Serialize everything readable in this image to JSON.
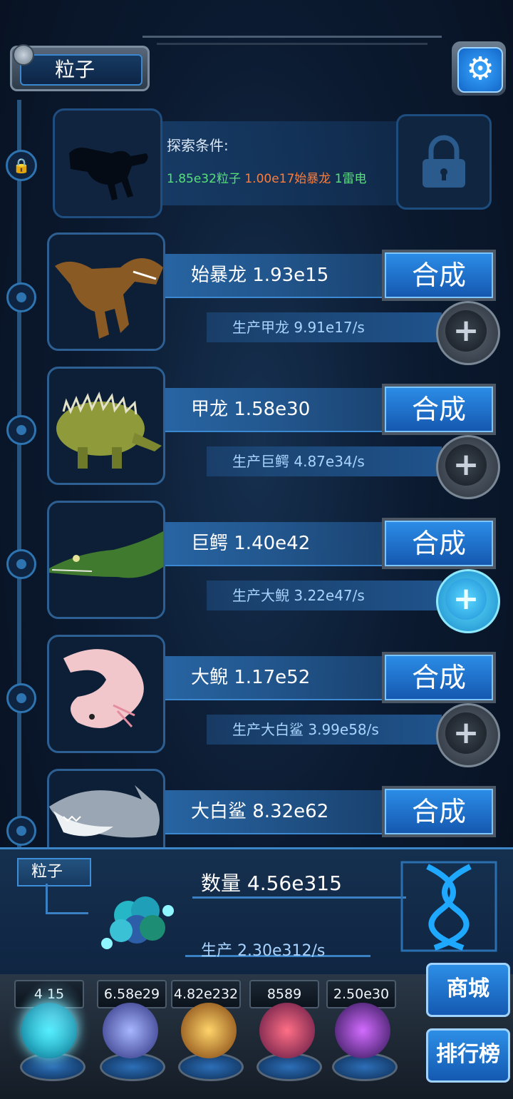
{
  "header": {
    "title": "粒子"
  },
  "explore": {
    "label": "探索条件:",
    "req_particle": "1.85e32粒子",
    "req_trex": "1.00e17始暴龙",
    "req_thunder": "1雷电"
  },
  "creatures": [
    {
      "name": "始暴龙",
      "count": "1.93e15",
      "produce": "生产甲龙 9.91e17/s",
      "combine": "合成",
      "upgrade_active": false
    },
    {
      "name": "甲龙",
      "count": "1.58e30",
      "produce": "生产巨鳄 4.87e34/s",
      "combine": "合成",
      "upgrade_active": false
    },
    {
      "name": "巨鳄",
      "count": "1.40e42",
      "produce": "生产大鲵 3.22e47/s",
      "combine": "合成",
      "upgrade_active": true
    },
    {
      "name": "大鲵",
      "count": "1.17e52",
      "produce": "生产大白鲨 3.99e58/s",
      "combine": "合成",
      "upgrade_active": false
    },
    {
      "name": "大白鲨",
      "count": "8.32e62",
      "produce": "",
      "combine": "合成",
      "upgrade_active": false
    }
  ],
  "creature_labels": [
    "始暴龙 1.93e15",
    "甲龙 1.58e30",
    "巨鳄 1.40e42",
    "大鲵 1.17e52",
    "大白鲨 8.32e62"
  ],
  "particle": {
    "label": "粒子",
    "count": "数量 4.56e315",
    "rate": "生产 2.30e312/s"
  },
  "resources": [
    {
      "value": "4.56e315",
      "visible": "4      15",
      "icon": "particle-orb-icon"
    },
    {
      "value": "6.58e29",
      "icon": "lightning-orb-icon"
    },
    {
      "value": "4.82e232",
      "icon": "fire-orb-icon"
    },
    {
      "value": "8589",
      "icon": "brain-orb-icon"
    },
    {
      "value": "2.50e30",
      "icon": "vortex-orb-icon"
    }
  ],
  "side": {
    "shop": "商城",
    "rank": "排行榜"
  },
  "colors": {
    "accent": "#2b8ce6",
    "req_green": "#58e07a",
    "req_orange": "#ff7d3a"
  }
}
